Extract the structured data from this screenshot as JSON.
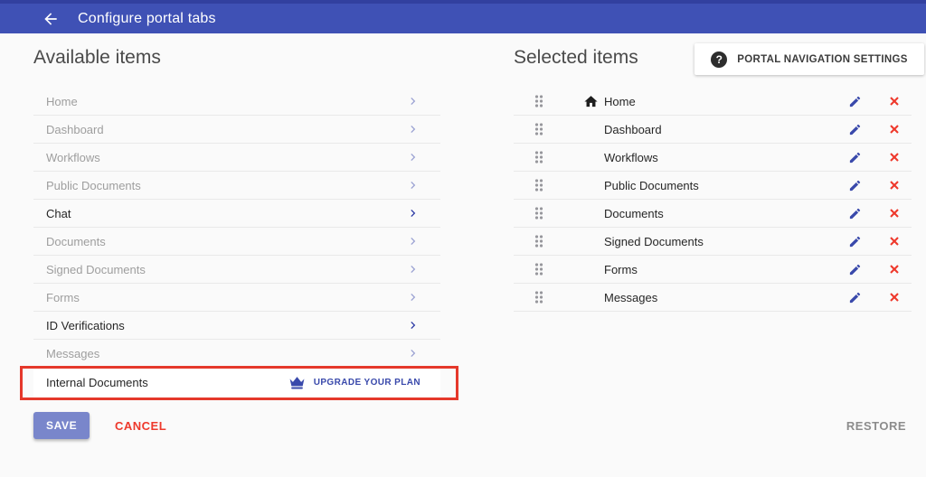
{
  "header": {
    "title": "Configure portal tabs"
  },
  "available": {
    "heading": "Available items",
    "items": [
      {
        "label": "Home",
        "state": "disabled"
      },
      {
        "label": "Dashboard",
        "state": "disabled"
      },
      {
        "label": "Workflows",
        "state": "disabled"
      },
      {
        "label": "Public Documents",
        "state": "disabled"
      },
      {
        "label": "Chat",
        "state": "enabled"
      },
      {
        "label": "Documents",
        "state": "disabled"
      },
      {
        "label": "Signed Documents",
        "state": "disabled"
      },
      {
        "label": "Forms",
        "state": "disabled"
      },
      {
        "label": "ID Verifications",
        "state": "enabled"
      },
      {
        "label": "Messages",
        "state": "disabled"
      },
      {
        "label": "Internal Documents",
        "state": "locked",
        "action_label": "UPGRADE YOUR PLAN",
        "highlighted": true
      }
    ]
  },
  "selected": {
    "heading": "Selected items",
    "settings_button": "PORTAL NAVIGATION SETTINGS",
    "help_glyph": "?",
    "items": [
      {
        "label": "Home",
        "icon": "home"
      },
      {
        "label": "Dashboard"
      },
      {
        "label": "Workflows"
      },
      {
        "label": "Public Documents"
      },
      {
        "label": "Documents"
      },
      {
        "label": "Signed Documents"
      },
      {
        "label": "Forms"
      },
      {
        "label": "Messages"
      }
    ]
  },
  "actions": {
    "save": "SAVE",
    "cancel": "CANCEL",
    "restore": "RESTORE"
  },
  "colors": {
    "primary": "#3F51B5",
    "primary_dark": "#32409F",
    "accent_indigo": "#3949AB",
    "muted_indigo": "#9BA2D3",
    "save_bg": "#7986CB",
    "red": "#EE392C",
    "highlight_border": "#E5382B",
    "text_dark": "#262626",
    "text_disabled": "#9E9E9E",
    "divider": "#E9E9E9",
    "heading": "#4A4A4A",
    "restore": "#8C8C8C",
    "page_bg": "#FAFAFA"
  }
}
